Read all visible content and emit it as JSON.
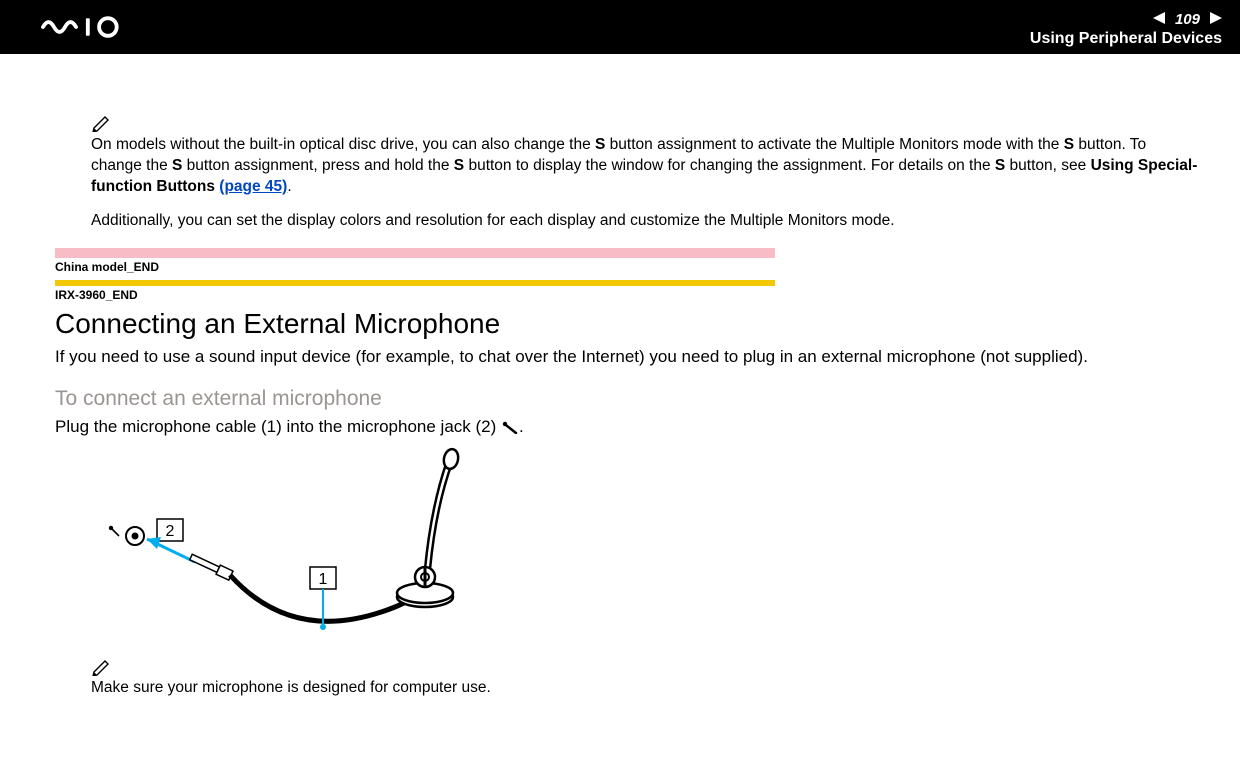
{
  "header": {
    "page_number": "109",
    "section_title": "Using Peripheral Devices"
  },
  "note1": {
    "line1_pre": "On models without the built-in optical disc drive, you can also change the ",
    "s1": "S",
    "line1_mid1": " button assignment to activate the Multiple Monitors mode with the ",
    "s2": "S",
    "line1_mid2": " button. To change the ",
    "s3": "S",
    "line1_mid3": " button assignment, press and hold the ",
    "s4": "S",
    "line1_mid4": " button to display the window for changing the assignment. For details on the ",
    "s5": "S",
    "line1_end": " button, see ",
    "bold_ref": "Using Special-function Buttons ",
    "link": "(page 45)",
    "dot": ".",
    "extra": "Additionally, you can set the display colors and resolution for each display and customize the Multiple Monitors mode."
  },
  "tags": {
    "china": "China model_END",
    "irx": "IRX-3960_END"
  },
  "heading": "Connecting an External Microphone",
  "intro": "If you need to use a sound input device (for example, to chat over the Internet) you need to plug in an external microphone (not supplied).",
  "sub_heading": "To connect an external microphone",
  "instruction_pre": "Plug the microphone cable (1) into the microphone jack (2) ",
  "instruction_post": ".",
  "figure": {
    "callout1": "1",
    "callout2": "2"
  },
  "note2": "Make sure your microphone is designed for computer use."
}
